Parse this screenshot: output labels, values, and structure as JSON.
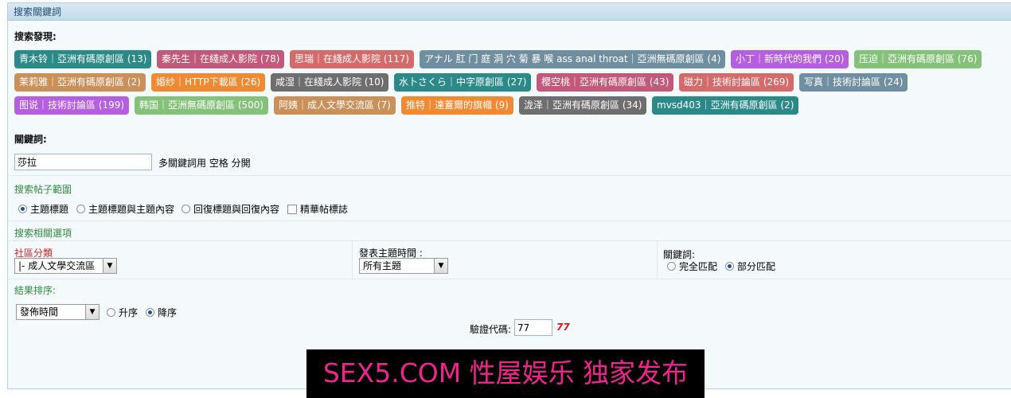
{
  "header": {
    "title": "搜索關鍵詞"
  },
  "discover": {
    "label": "搜索發現:",
    "tags": [
      {
        "text": "青木铃｜亞洲有碼原創區 (13)",
        "color": "#2b8a87"
      },
      {
        "text": "秦先生｜在綫成人影院 (78)",
        "color": "#c2587a"
      },
      {
        "text": "思瑞｜在綫成人影院 (117)",
        "color": "#d46b6b"
      },
      {
        "text": "アナル 肛 门 庭 洞 穴 菊 暴 喉 ass anal throat｜亞洲無碼原創區 (4)",
        "color": "#6f8fa0"
      },
      {
        "text": "小丁｜新時代的我們 (20)",
        "color": "#b65ee0"
      },
      {
        "text": "压迫｜亞洲有碼原創區 (76)",
        "color": "#84c27a"
      },
      {
        "text": "茉莉雅｜亞洲有碼原創區 (2)",
        "color": "#c9905a"
      },
      {
        "text": "婚纱｜HTTP下載區 (26)",
        "color": "#f08a32"
      },
      {
        "text": "咸湿｜在綫成人影院 (10)",
        "color": "#6e6e6e"
      },
      {
        "text": "水卜さくら｜中字原創區 (27)",
        "color": "#2b8a87"
      },
      {
        "text": "樱空桃｜亞洲有碼原創區 (43)",
        "color": "#c2587a"
      },
      {
        "text": "磁力｜技術討論區 (269)",
        "color": "#d46b6b"
      },
      {
        "text": "写真｜技術討論區 (24)",
        "color": "#6f8fa0"
      },
      {
        "text": "图说｜技術討論區 (199)",
        "color": "#b65ee0"
      },
      {
        "text": "韩国｜亞洲無碼原創區 (500)",
        "color": "#84c27a"
      },
      {
        "text": "阿姨｜成人文學交流區 (7)",
        "color": "#c9905a"
      },
      {
        "text": "推特｜達蓋爾的旗幟 (9)",
        "color": "#f08a32"
      },
      {
        "text": "泷泽｜亞洲有碼原創區 (34)",
        "color": "#6e6e6e"
      },
      {
        "text": "mvsd403｜亞洲有碼原創區 (2)",
        "color": "#2b8a87"
      }
    ]
  },
  "keyword": {
    "label": "關鍵詞:",
    "value": "莎拉",
    "hint": "多關鍵詞用 空格 分開"
  },
  "scope": {
    "title": "搜索帖子範圍",
    "options": [
      "主題標題",
      "主題標題與主題內容",
      "回復標題與回復內容"
    ],
    "selected": 0,
    "checkbox_label": "精華帖標誌"
  },
  "related": {
    "title": "搜索相關選項",
    "forum_label": "社區分類",
    "forum_value": "|- 成人文學交流區",
    "time_label": "發表主題時間 :",
    "time_value": "所有主題",
    "match_label": "關鍵詞:",
    "match_options": [
      "完全匹配",
      "部分匹配"
    ],
    "match_selected": 1
  },
  "sort": {
    "title": "結果排序:",
    "field_value": "發佈時間",
    "order_options": [
      "升序",
      "降序"
    ],
    "order_selected": 1
  },
  "captcha": {
    "label": "驗證代碼:",
    "value": "77",
    "code": "77",
    "code_color": "#d11a1a"
  },
  "banner": {
    "text": "SEX5.COM 性屋娱乐 独家发布",
    "color": "#f0248e"
  },
  "colors": {
    "header_bg": "#c3dbe8",
    "section_title": "#2f8a3c",
    "forum_label": "#cc2222"
  }
}
